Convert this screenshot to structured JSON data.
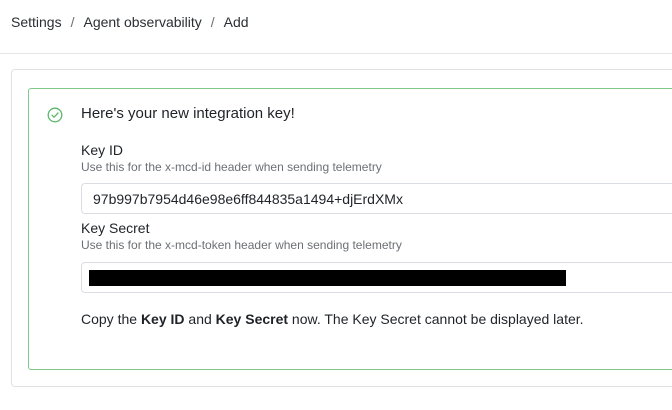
{
  "breadcrumb": {
    "items": [
      "Settings",
      "Agent observability",
      "Add"
    ],
    "separator": "/"
  },
  "success": {
    "headline": "Here's your new integration key!",
    "icon": "check-circle-icon",
    "border_color": "#7fc88a"
  },
  "key_id": {
    "label": "Key ID",
    "hint": "Use this for the x-mcd-id header when sending telemetry",
    "value": "97b997b7954d46e98e6ff844835a1494+djErdXMx"
  },
  "key_secret": {
    "label": "Key Secret",
    "hint": "Use this for the x-mcd-token header when sending telemetry",
    "value_redacted": true
  },
  "note": {
    "prefix": "Copy the ",
    "bold1": "Key ID",
    "middle": " and ",
    "bold2": "Key Secret",
    "suffix": " now. The Key Secret cannot be displayed later."
  }
}
